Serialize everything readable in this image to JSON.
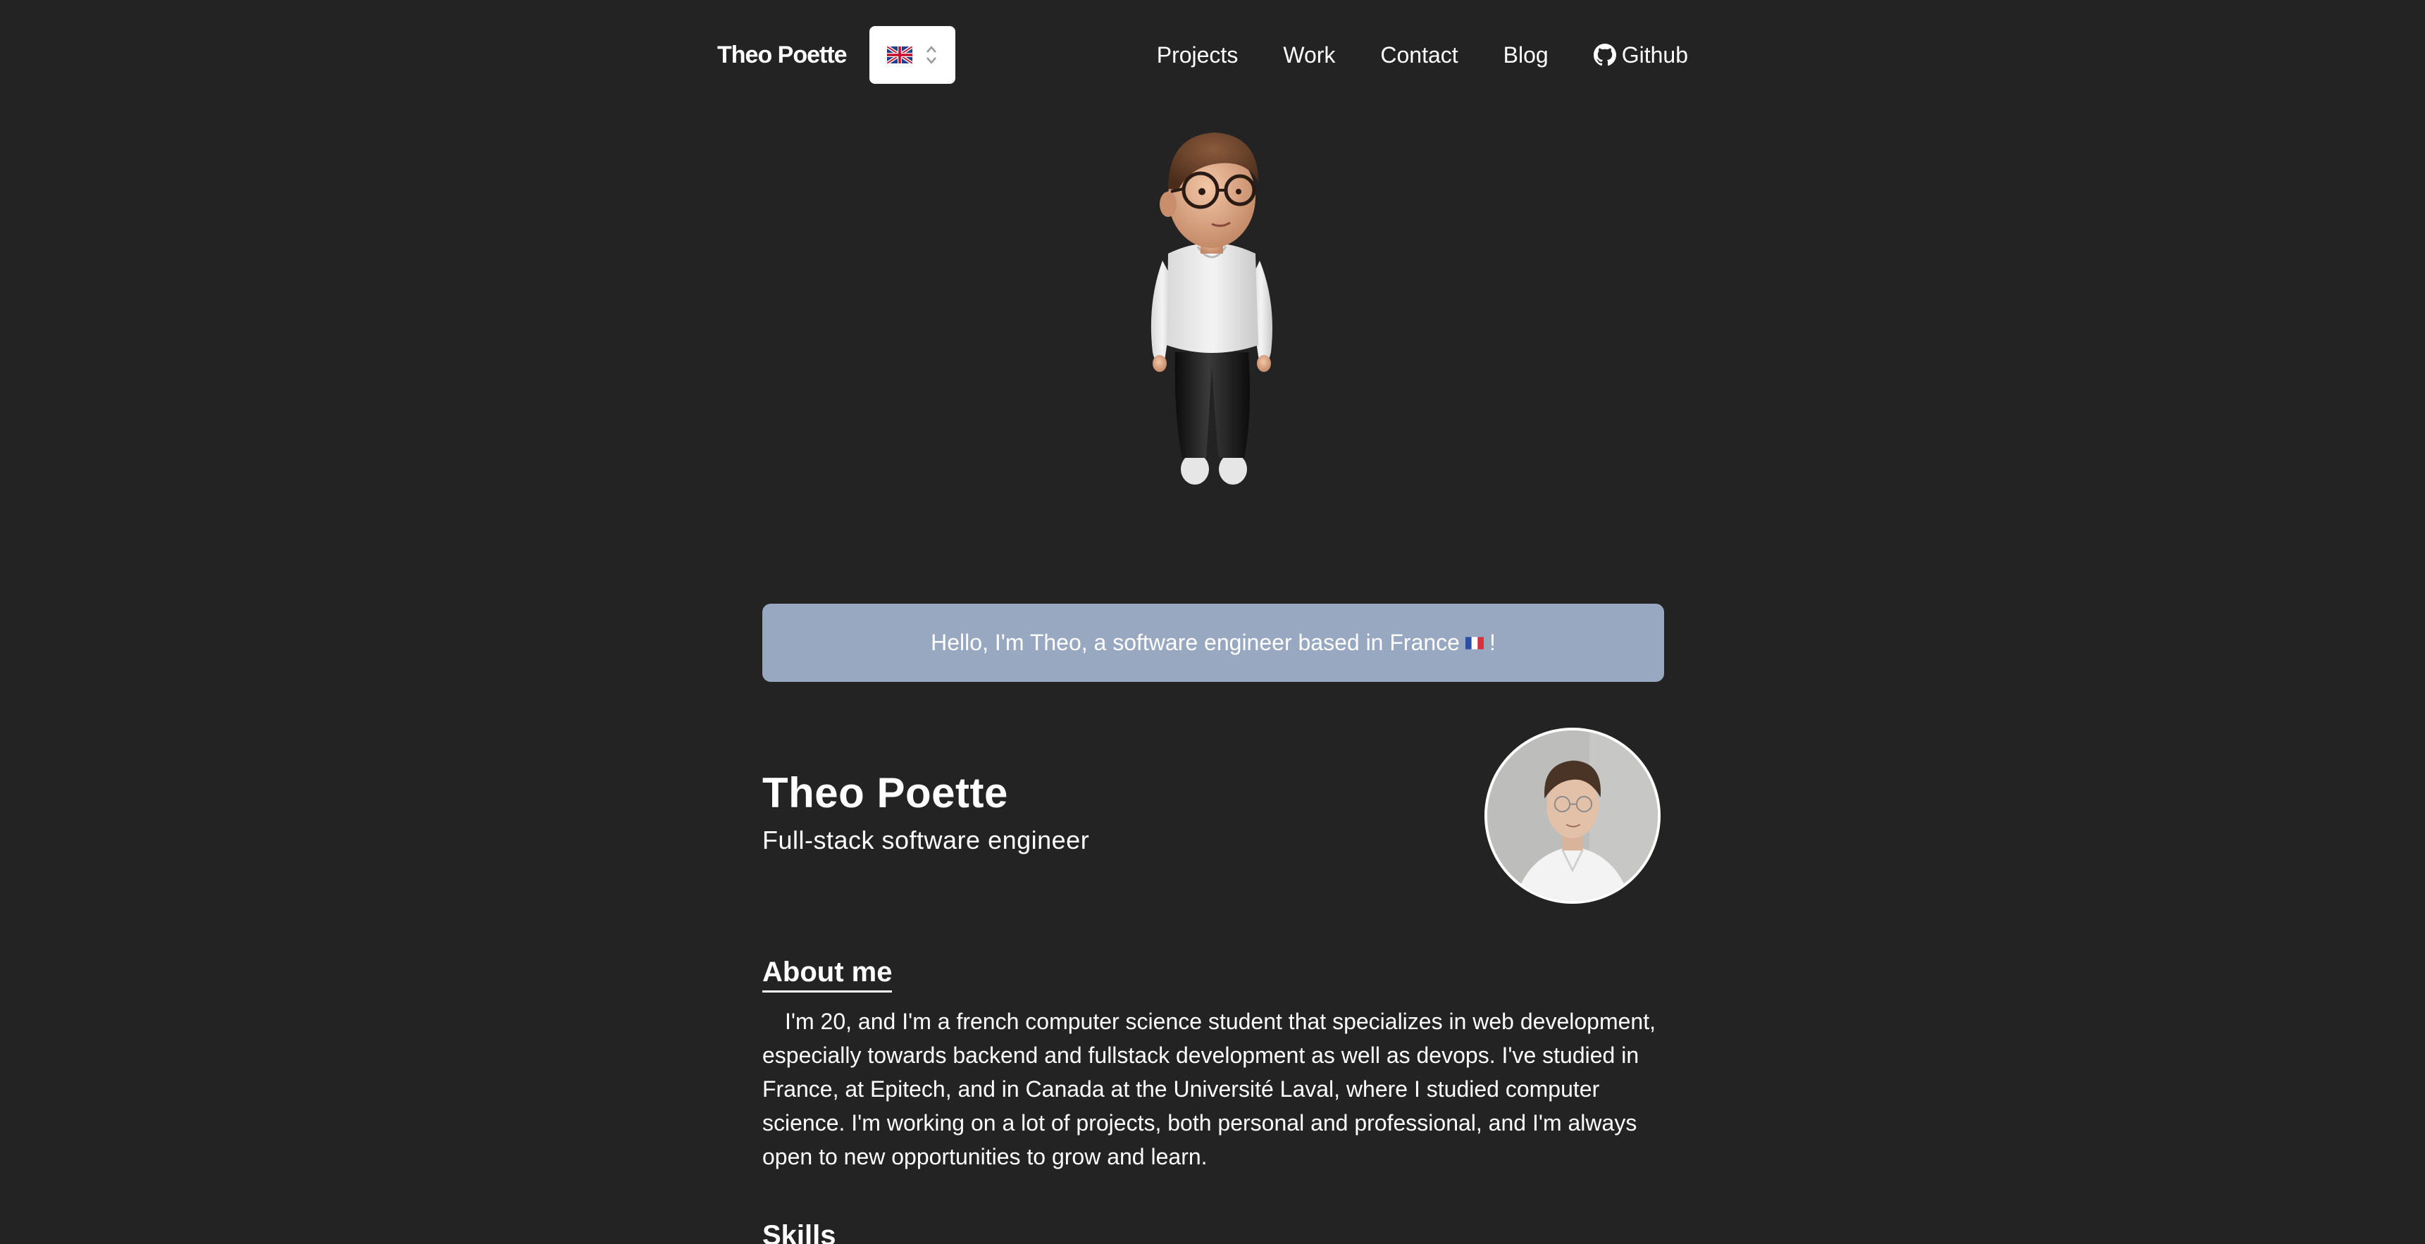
{
  "header": {
    "brand": "Theo Poette",
    "language": {
      "selected": "🇬🇧",
      "flag_icon": "uk-flag-icon",
      "chevron_icon": "chevron-updown-icon"
    },
    "nav": [
      {
        "label": "Projects"
      },
      {
        "label": "Work"
      },
      {
        "label": "Contact"
      },
      {
        "label": "Blog"
      },
      {
        "label": "Github",
        "icon": "github-icon"
      }
    ]
  },
  "hero": {
    "avatar_icon": "3d-avatar-character"
  },
  "greeting": {
    "text_before": "Hello, I'm Theo, a software engineer based in France",
    "flag_icon": "france-flag-icon",
    "text_after": "!",
    "background": "#97a8c0"
  },
  "profile": {
    "name": "Theo Poette",
    "role": "Full-stack software engineer",
    "photo_icon": "profile-photo"
  },
  "about": {
    "title": "About me",
    "body": "I'm 20, and I'm a french computer science student that specializes in web development, especially towards backend and fullstack development as well as devops. I've studied in France, at Epitech, and in Canada at the Université Laval, where I studied computer science. I'm working on a lot of projects, both personal and professional, and I'm always open to new opportunities to grow and learn."
  },
  "skills": {
    "title": "Skills"
  },
  "colors": {
    "background": "#232323",
    "text": "#ffffff",
    "banner": "#97a8c0"
  }
}
